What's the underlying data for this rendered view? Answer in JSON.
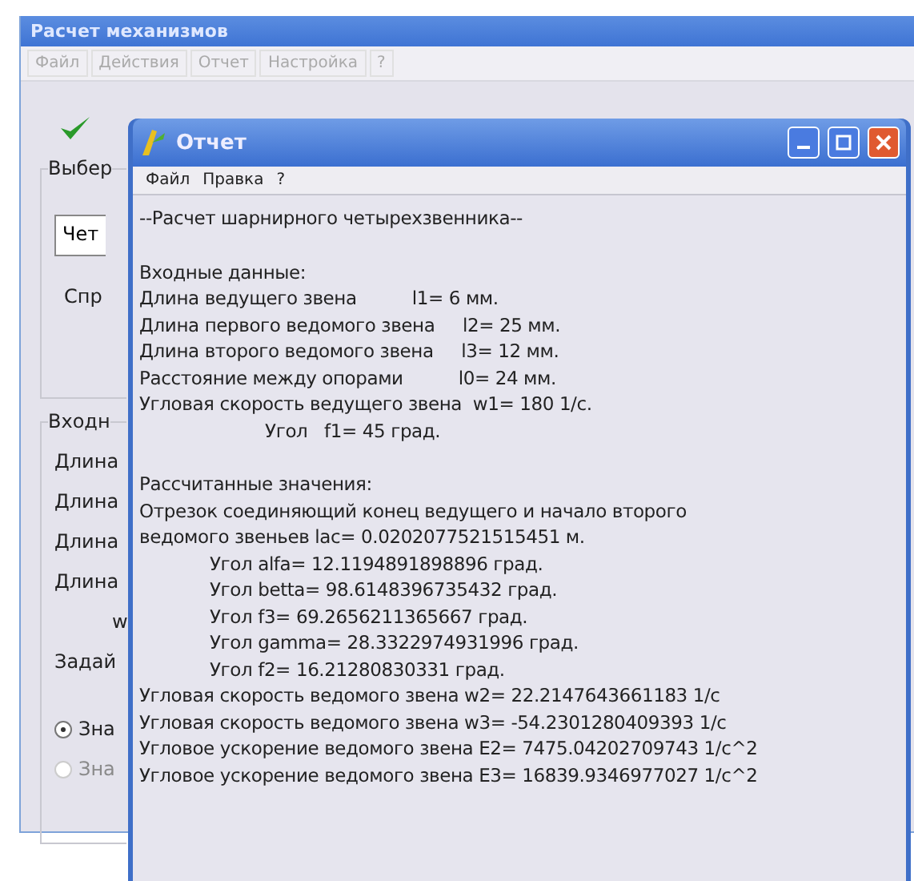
{
  "main_window": {
    "title": "Расчет механизмов",
    "menu": [
      "Файл",
      "Действия",
      "Отчет",
      "Настройка",
      "?"
    ],
    "choose_group": {
      "title": "Выбер",
      "combo_value": "Чет",
      "label": "Спр"
    },
    "input_group": {
      "title": "Входн",
      "labels": [
        "Длина",
        "Длина",
        "Длина",
        "Длина",
        "w"
      ],
      "prompt": "Задай",
      "radios": [
        {
          "label": "Зна",
          "selected": true,
          "disabled": false
        },
        {
          "label": "Зна",
          "selected": false,
          "disabled": true
        }
      ]
    }
  },
  "report_window": {
    "title": "Отчет",
    "menu": [
      "Файл",
      "Правка",
      "?"
    ],
    "blocks": [
      {
        "lines": [
          {
            "text": "--Расчет шарнирного четырехзвенника--",
            "indented": false
          }
        ]
      },
      {
        "lines": [
          {
            "text": "Входные данные:",
            "indented": false
          },
          {
            "text": "Длина ведущего звена          l1= 6 мм.",
            "indented": false
          },
          {
            "text": "Длина первого ведомого звена     l2= 25 мм.",
            "indented": false
          },
          {
            "text": "Длина второго ведомого звена     l3= 12 мм.",
            "indented": false
          },
          {
            "text": "Расстояние между опорами          l0= 24 мм.",
            "indented": false
          },
          {
            "text": "Угловая скорость ведущего звена  w1= 180 1/с.",
            "indented": false
          },
          {
            "text": "          Угол   f1= 45 град.",
            "indented": true
          }
        ]
      },
      {
        "lines": [
          {
            "text": "Рассчитанные значения:",
            "indented": false
          },
          {
            "text": "Отрезок соединяющий конец ведущего и начало второго",
            "indented": false
          },
          {
            "text": "ведомого звеньев lac= 0.0202077521515451 м.",
            "indented": false
          },
          {
            "text": "Угол alfa= 12.1194891898896 град.",
            "indented": true
          },
          {
            "text": "Угол betta= 98.6148396735432 град.",
            "indented": true
          },
          {
            "text": "Угол f3= 69.2656211365667 град.",
            "indented": true
          },
          {
            "text": "Угол gamma= 28.3322974931996 град.",
            "indented": true
          },
          {
            "text": "Угол f2= 16.21280830331 град.",
            "indented": true
          },
          {
            "text": "Угловая скорость ведомого звена w2= 22.2147643661183 1/с",
            "indented": false
          },
          {
            "text": "Угловая скорость ведомого звена w3= -54.2301280409393 1/с",
            "indented": false
          },
          {
            "text": "Угловое ускорение ведомого звена E2= 7475.04202709743 1/с^2",
            "indented": false
          },
          {
            "text": "Угловое ускорение ведомого звена E3= 16839.9346977027 1/с^2",
            "indented": false
          }
        ]
      }
    ]
  }
}
